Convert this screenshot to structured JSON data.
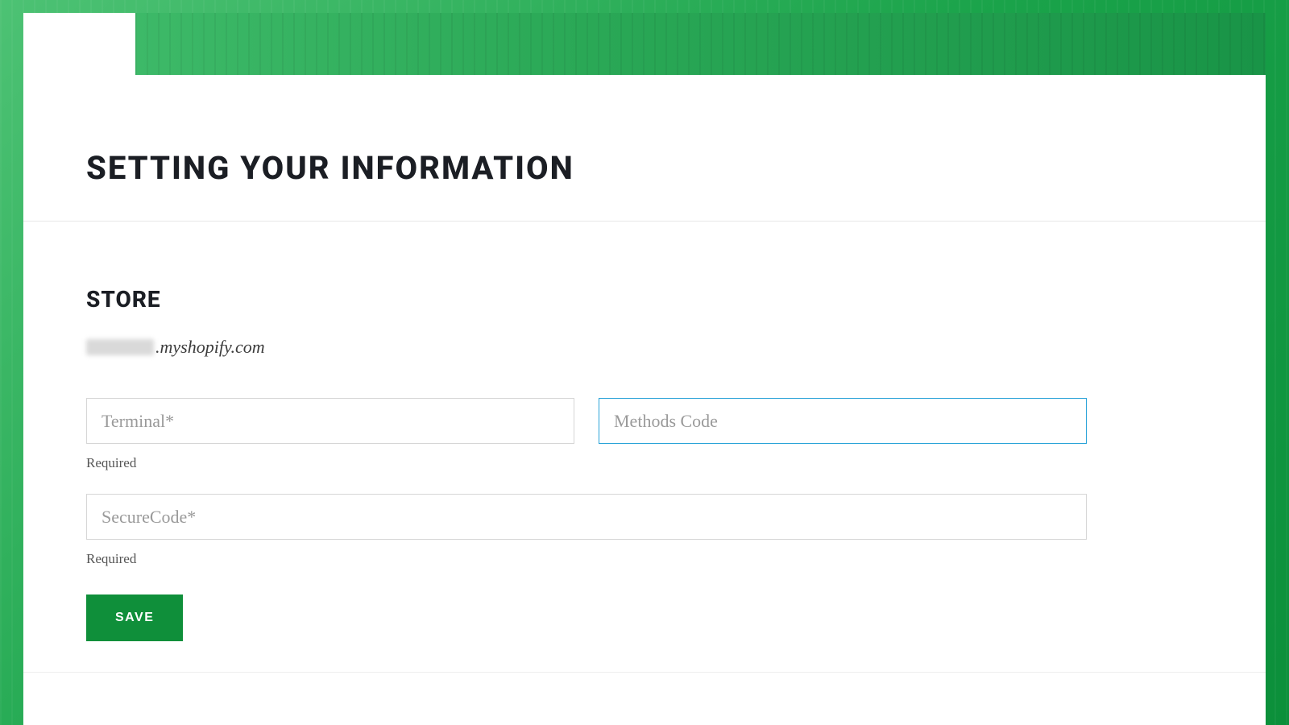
{
  "header": {
    "title": "SETTING YOUR INFORMATION"
  },
  "store": {
    "section_title": "STORE",
    "domain_suffix": ".myshopify.com"
  },
  "form": {
    "terminal": {
      "placeholder": "Terminal*",
      "value": "",
      "helper": "Required"
    },
    "methods_code": {
      "placeholder": "Methods Code",
      "value": ""
    },
    "secure_code": {
      "placeholder": "SecureCode*",
      "value": "",
      "helper": "Required"
    }
  },
  "actions": {
    "save_label": "SAVE"
  },
  "colors": {
    "accent_green": "#0f8f3a",
    "focus_blue": "#2aa3d8"
  }
}
